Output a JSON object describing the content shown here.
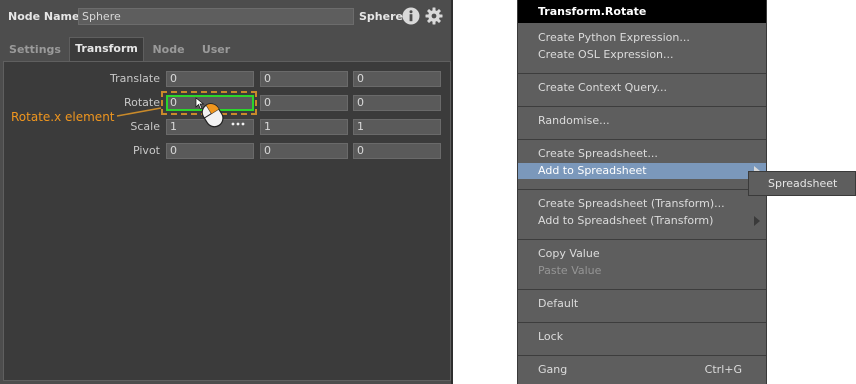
{
  "node_editor": {
    "name_label": "Node Name",
    "name_value": "Sphere",
    "node_type": "Sphere",
    "tabs": [
      {
        "label": "Settings",
        "active": false
      },
      {
        "label": "Transform",
        "active": true
      },
      {
        "label": "Node",
        "active": false
      },
      {
        "label": "User",
        "active": false
      }
    ],
    "rows": [
      {
        "label": "Translate",
        "values": [
          "0",
          "0",
          "0"
        ]
      },
      {
        "label": "Rotate",
        "values": [
          "0",
          "0",
          "0"
        ]
      },
      {
        "label": "Scale",
        "values": [
          "1",
          "1",
          "1"
        ]
      },
      {
        "label": "Pivot",
        "values": [
          "0",
          "0",
          "0"
        ]
      }
    ],
    "annotation": "Rotate.x element"
  },
  "context_menu": {
    "title": "Transform.Rotate",
    "items": {
      "python_expr": "Create Python Expression...",
      "osl_expr": "Create OSL Expression...",
      "context_query": "Create Context Query...",
      "randomise": "Randomise...",
      "create_spreadsheet": "Create Spreadsheet...",
      "add_to_spreadsheet": "Add to Spreadsheet",
      "create_spreadsheet_transform": "Create Spreadsheet (Transform)...",
      "add_to_spreadsheet_transform": "Add to Spreadsheet (Transform)",
      "copy_value": "Copy Value",
      "paste_value": "Paste Value",
      "default": "Default",
      "lock": "Lock",
      "gang": "Gang",
      "gang_shortcut": "Ctrl+G"
    },
    "submenu_item": "Spreadsheet"
  },
  "colors": {
    "highlight_border": "#2bd52b",
    "annotation": "#f0961e",
    "menu_hover": "#7b98bb"
  }
}
